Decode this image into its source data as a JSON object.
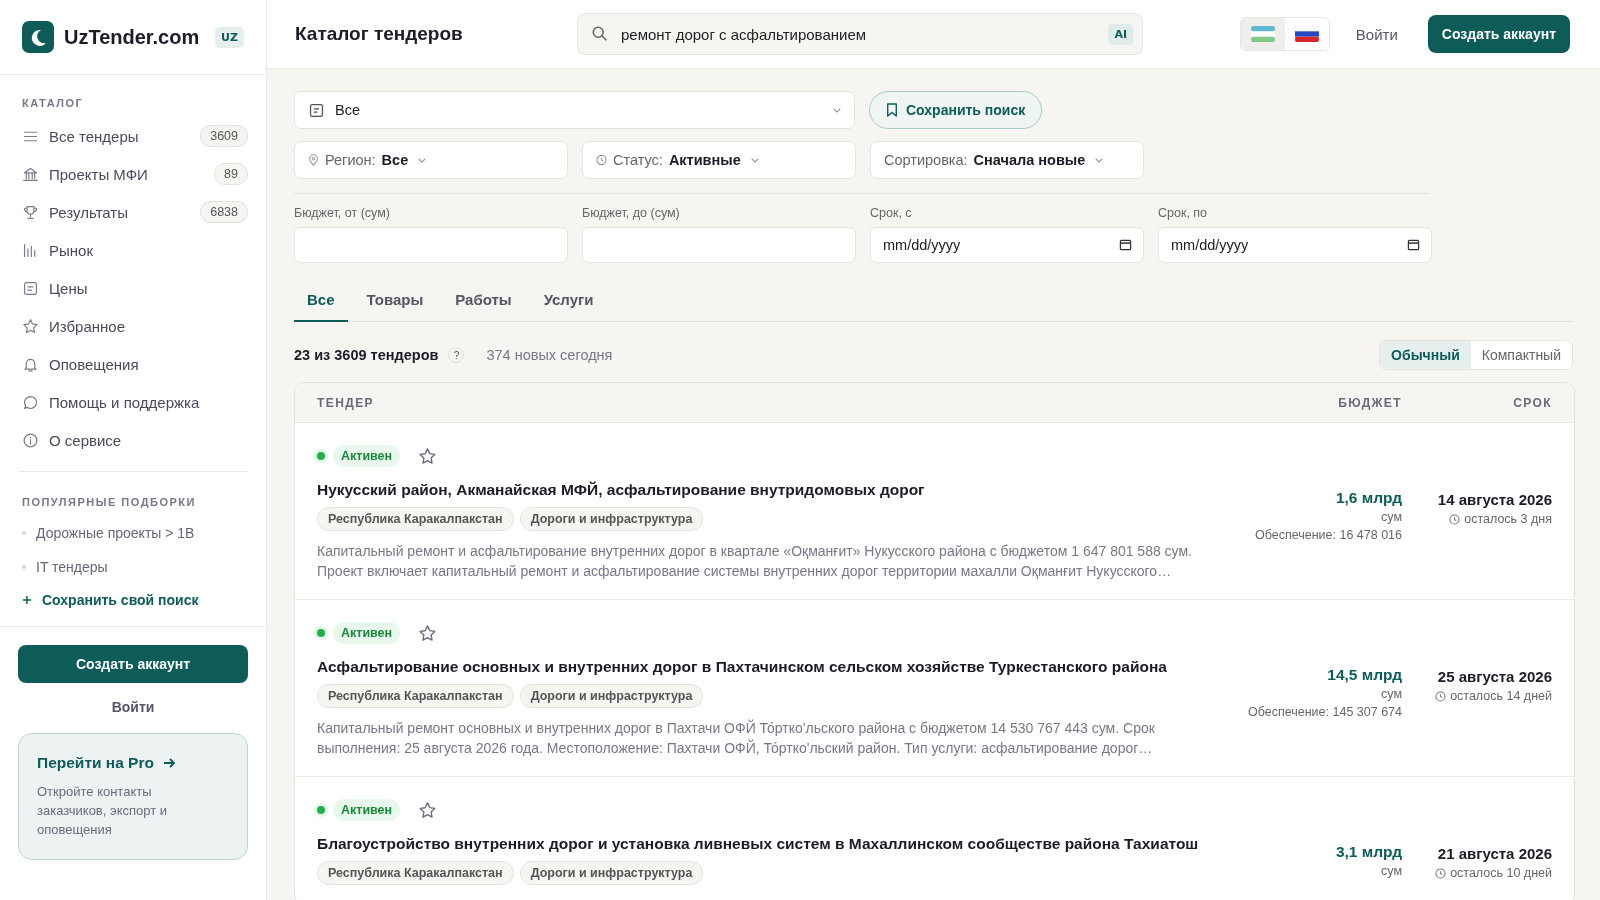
{
  "brand": {
    "name": "UzTender.com",
    "badge": "UZ"
  },
  "sidebar": {
    "catalog_heading": "КАТАЛОГ",
    "items": [
      {
        "label": "Все тендеры",
        "count": "3609"
      },
      {
        "label": "Проекты МФИ",
        "count": "89"
      },
      {
        "label": "Результаты",
        "count": "6838"
      },
      {
        "label": "Рынок"
      },
      {
        "label": "Цены"
      },
      {
        "label": "Избранное"
      },
      {
        "label": "Оповещения"
      },
      {
        "label": "Помощь и поддержка"
      },
      {
        "label": "О сервисе"
      }
    ],
    "popular_heading": "ПОПУЛЯРНЫЕ ПОДБОРКИ",
    "popular": [
      "Дорожные проекты > 1B",
      "IT тендеры"
    ],
    "save_link": "Сохранить свой поиск",
    "signup_button": "Создать аккаунт",
    "login_link": "Войти",
    "promo": {
      "title": "Перейти на Pro",
      "text": "Откройте контакты заказчиков, экспорт и оповещения"
    }
  },
  "header": {
    "title": "Каталог тендеров",
    "search": {
      "value": "ремонт дорог с асфальтированием",
      "badge": "AI"
    },
    "languages": [
      {
        "kind": "uz",
        "selected": true
      },
      {
        "kind": "ru",
        "selected": false
      }
    ],
    "login": "Войти",
    "signup": "Создать аккаунт"
  },
  "filters": {
    "category": "Все",
    "save_search": "Сохранить поиск",
    "selects": [
      {
        "label": "Регион:",
        "value": "Все"
      },
      {
        "label": "Статус:",
        "value": "Активные"
      },
      {
        "label": "Сортировка:",
        "value": "Сначала новые"
      }
    ],
    "fields": [
      {
        "label": "Бюджет, от (сум)"
      },
      {
        "label": "Бюджет, до (сум)"
      },
      {
        "label": "Срок, с",
        "placeholder": "mm/dd/yyyy"
      },
      {
        "label": "Срок, по",
        "placeholder": "mm/dd/yyyy"
      }
    ]
  },
  "tabs": [
    {
      "label": "Все",
      "selected": true
    },
    {
      "label": "Товары",
      "selected": false
    },
    {
      "label": "Работы",
      "selected": false
    },
    {
      "label": "Услуги",
      "selected": false
    }
  ],
  "summary": {
    "count": "23 из 3609 тендеров",
    "help": "?",
    "new_today": "374 новых сегодня"
  },
  "view_toggle": [
    {
      "label": "Обычный",
      "selected": true
    },
    {
      "label": "Компактный",
      "selected": false
    }
  ],
  "table": {
    "columns": [
      "ТЕНДЕР",
      "БЮДЖЕТ",
      "СРОК"
    ],
    "rows": [
      {
        "status": "Активен",
        "favorite": false,
        "title": "Нукусский район, Акманайская МФЙ, асфальтирование внутридомовых дорог",
        "tags": [
          "Республика Каракалпакстан",
          "Дороги и инфраструктура"
        ],
        "description": "Капитальный ремонт и асфальтирование внутренних дорог в квартале «Оқманғит» Нукусского района с бюджетом 1 647 801 588 сум. Проект включает капитальный ремонт и асфальтирование системы внутренних дорог территории махалли Оқманғит Нукусского…",
        "budget": "1,6 млрд",
        "currency": "сум",
        "security": "Обеспечение: 16 478 016",
        "date": "14 августа 2026",
        "remaining": "осталось 3 дня"
      },
      {
        "status": "Активен",
        "favorite": false,
        "title": "Асфальтирование основных и внутренних дорог в Пахтачинском сельском хозяйстве Туркестанского района",
        "tags": [
          "Республика Каракалпакстан",
          "Дороги и инфраструктура"
        ],
        "description": "Капитальный ремонт основных и внутренних дорог в Пахтачи ОФЙ То́ртко'льского района с бюджетом 14 530 767 443 сум. Срок выполнения: 25 августа 2026 года. Местоположение: Пахтачи ОФЙ, То́ртко'льский район. Тип услуги: асфальтирование дорог…",
        "budget": "14,5 млрд",
        "currency": "сум",
        "security": "Обеспечение: 145 307 674",
        "date": "25 августа 2026",
        "remaining": "осталось 14 дней"
      },
      {
        "status": "Активен",
        "favorite": false,
        "title": "Благоустройство внутренних дорог и установка ливневых систем в Махаллинском сообществе района Тахиатош",
        "tags": [
          "Республика Каракалпакстан",
          "Дороги и инфраструктура"
        ],
        "budget": "3,1 млрд",
        "currency": "сум",
        "date": "21 августа 2026",
        "remaining": "осталось 10 дней"
      }
    ]
  }
}
